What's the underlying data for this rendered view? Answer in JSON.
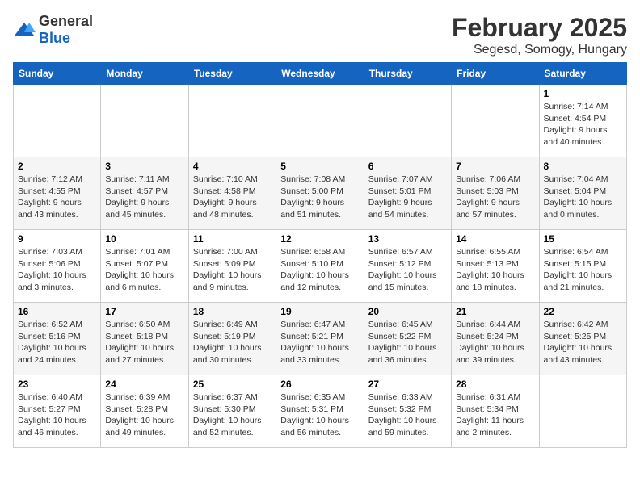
{
  "logo": {
    "text_general": "General",
    "text_blue": "Blue"
  },
  "title": "February 2025",
  "subtitle": "Segesd, Somogy, Hungary",
  "days_of_week": [
    "Sunday",
    "Monday",
    "Tuesday",
    "Wednesday",
    "Thursday",
    "Friday",
    "Saturday"
  ],
  "weeks": [
    [
      {
        "day": "",
        "info": ""
      },
      {
        "day": "",
        "info": ""
      },
      {
        "day": "",
        "info": ""
      },
      {
        "day": "",
        "info": ""
      },
      {
        "day": "",
        "info": ""
      },
      {
        "day": "",
        "info": ""
      },
      {
        "day": "1",
        "info": "Sunrise: 7:14 AM\nSunset: 4:54 PM\nDaylight: 9 hours and 40 minutes."
      }
    ],
    [
      {
        "day": "2",
        "info": "Sunrise: 7:12 AM\nSunset: 4:55 PM\nDaylight: 9 hours and 43 minutes."
      },
      {
        "day": "3",
        "info": "Sunrise: 7:11 AM\nSunset: 4:57 PM\nDaylight: 9 hours and 45 minutes."
      },
      {
        "day": "4",
        "info": "Sunrise: 7:10 AM\nSunset: 4:58 PM\nDaylight: 9 hours and 48 minutes."
      },
      {
        "day": "5",
        "info": "Sunrise: 7:08 AM\nSunset: 5:00 PM\nDaylight: 9 hours and 51 minutes."
      },
      {
        "day": "6",
        "info": "Sunrise: 7:07 AM\nSunset: 5:01 PM\nDaylight: 9 hours and 54 minutes."
      },
      {
        "day": "7",
        "info": "Sunrise: 7:06 AM\nSunset: 5:03 PM\nDaylight: 9 hours and 57 minutes."
      },
      {
        "day": "8",
        "info": "Sunrise: 7:04 AM\nSunset: 5:04 PM\nDaylight: 10 hours and 0 minutes."
      }
    ],
    [
      {
        "day": "9",
        "info": "Sunrise: 7:03 AM\nSunset: 5:06 PM\nDaylight: 10 hours and 3 minutes."
      },
      {
        "day": "10",
        "info": "Sunrise: 7:01 AM\nSunset: 5:07 PM\nDaylight: 10 hours and 6 minutes."
      },
      {
        "day": "11",
        "info": "Sunrise: 7:00 AM\nSunset: 5:09 PM\nDaylight: 10 hours and 9 minutes."
      },
      {
        "day": "12",
        "info": "Sunrise: 6:58 AM\nSunset: 5:10 PM\nDaylight: 10 hours and 12 minutes."
      },
      {
        "day": "13",
        "info": "Sunrise: 6:57 AM\nSunset: 5:12 PM\nDaylight: 10 hours and 15 minutes."
      },
      {
        "day": "14",
        "info": "Sunrise: 6:55 AM\nSunset: 5:13 PM\nDaylight: 10 hours and 18 minutes."
      },
      {
        "day": "15",
        "info": "Sunrise: 6:54 AM\nSunset: 5:15 PM\nDaylight: 10 hours and 21 minutes."
      }
    ],
    [
      {
        "day": "16",
        "info": "Sunrise: 6:52 AM\nSunset: 5:16 PM\nDaylight: 10 hours and 24 minutes."
      },
      {
        "day": "17",
        "info": "Sunrise: 6:50 AM\nSunset: 5:18 PM\nDaylight: 10 hours and 27 minutes."
      },
      {
        "day": "18",
        "info": "Sunrise: 6:49 AM\nSunset: 5:19 PM\nDaylight: 10 hours and 30 minutes."
      },
      {
        "day": "19",
        "info": "Sunrise: 6:47 AM\nSunset: 5:21 PM\nDaylight: 10 hours and 33 minutes."
      },
      {
        "day": "20",
        "info": "Sunrise: 6:45 AM\nSunset: 5:22 PM\nDaylight: 10 hours and 36 minutes."
      },
      {
        "day": "21",
        "info": "Sunrise: 6:44 AM\nSunset: 5:24 PM\nDaylight: 10 hours and 39 minutes."
      },
      {
        "day": "22",
        "info": "Sunrise: 6:42 AM\nSunset: 5:25 PM\nDaylight: 10 hours and 43 minutes."
      }
    ],
    [
      {
        "day": "23",
        "info": "Sunrise: 6:40 AM\nSunset: 5:27 PM\nDaylight: 10 hours and 46 minutes."
      },
      {
        "day": "24",
        "info": "Sunrise: 6:39 AM\nSunset: 5:28 PM\nDaylight: 10 hours and 49 minutes."
      },
      {
        "day": "25",
        "info": "Sunrise: 6:37 AM\nSunset: 5:30 PM\nDaylight: 10 hours and 52 minutes."
      },
      {
        "day": "26",
        "info": "Sunrise: 6:35 AM\nSunset: 5:31 PM\nDaylight: 10 hours and 56 minutes."
      },
      {
        "day": "27",
        "info": "Sunrise: 6:33 AM\nSunset: 5:32 PM\nDaylight: 10 hours and 59 minutes."
      },
      {
        "day": "28",
        "info": "Sunrise: 6:31 AM\nSunset: 5:34 PM\nDaylight: 11 hours and 2 minutes."
      },
      {
        "day": "",
        "info": ""
      }
    ]
  ]
}
